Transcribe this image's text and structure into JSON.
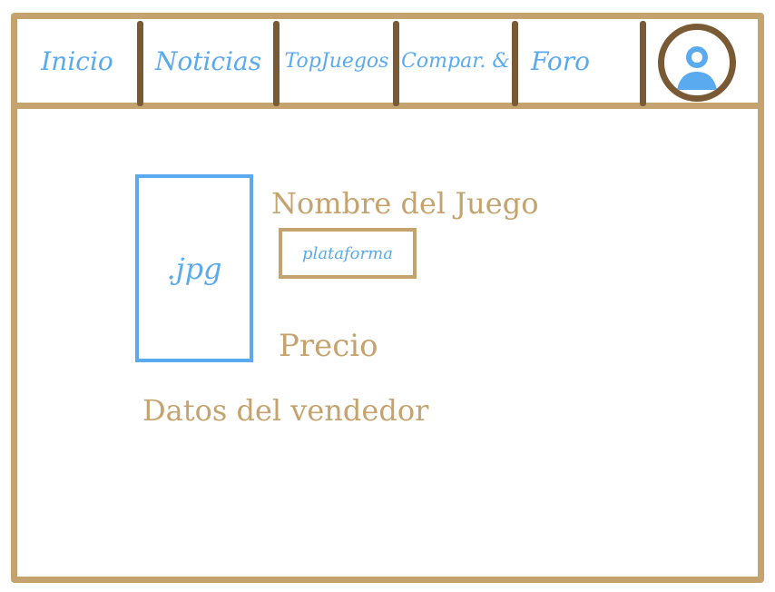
{
  "nav": {
    "items": [
      {
        "label": "Inicio"
      },
      {
        "label": "Noticias"
      },
      {
        "label": "TopJuegos"
      },
      {
        "label": "Compar. &"
      },
      {
        "label": "Foro"
      }
    ],
    "avatar_icon": "user-avatar-icon"
  },
  "product": {
    "image_placeholder": ".jpg",
    "name": "Nombre del Juego",
    "platform": "plataforma",
    "price": "Precio",
    "seller_info": "Datos del vendedor"
  },
  "colors": {
    "frame": "#c4a36e",
    "divider": "#7a5a34",
    "accent": "#5aaaf0"
  }
}
